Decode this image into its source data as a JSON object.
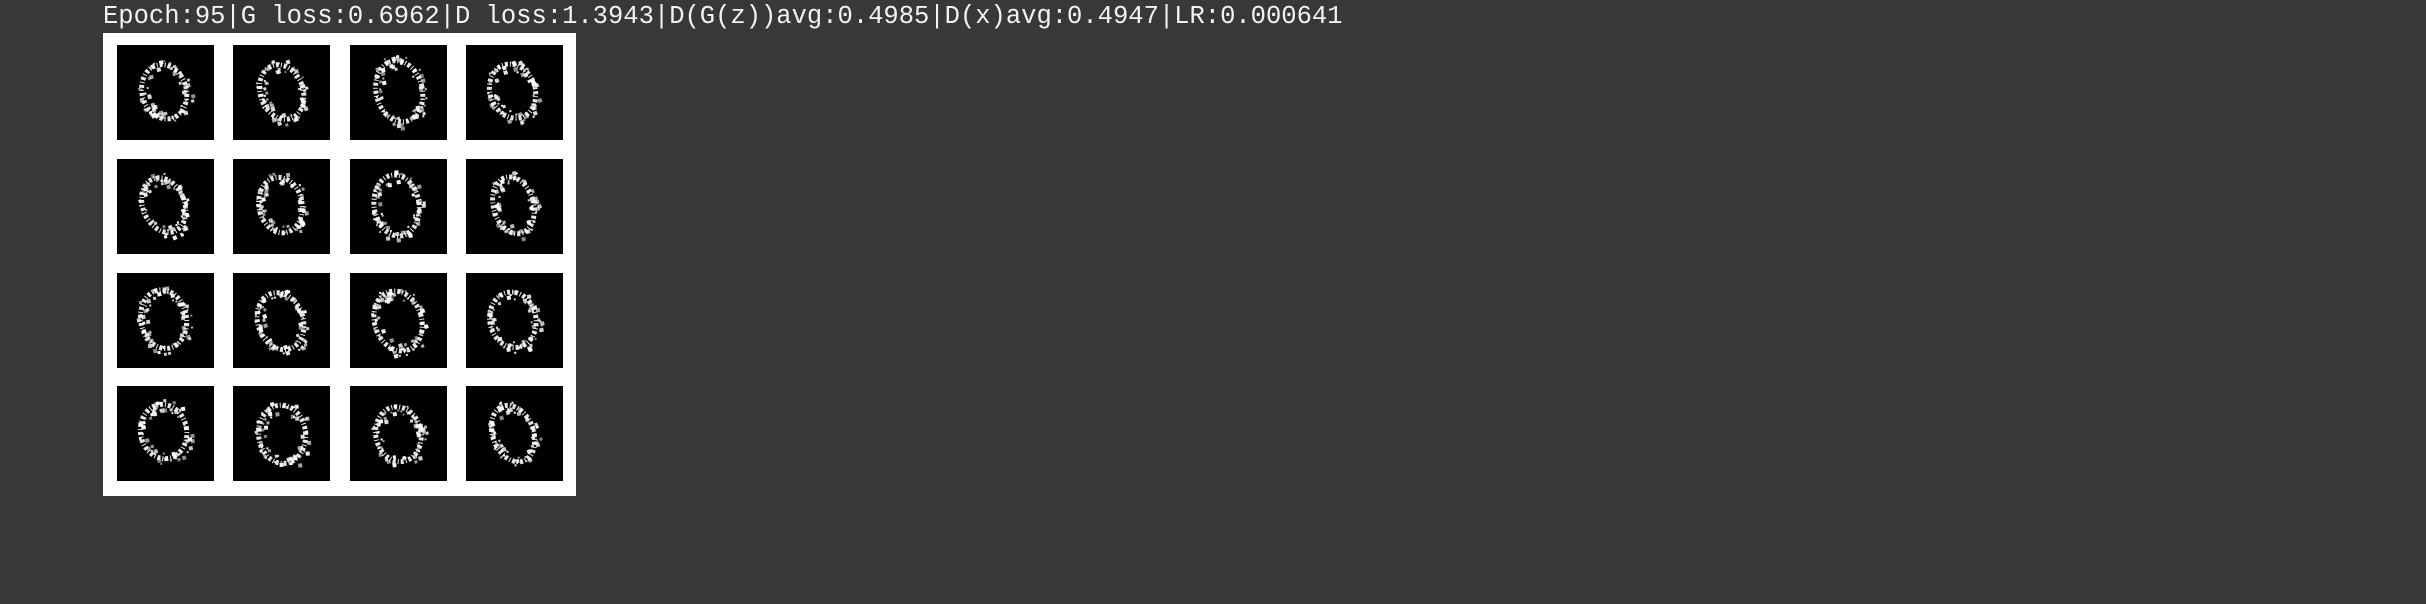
{
  "training_log": {
    "line": "Epoch:95|G loss:0.6962|D loss:1.3943|D(G(z))avg:0.4985|D(x)avg:0.4947|LR:0.000641"
  },
  "samples_grid": {
    "rows": 4,
    "cols": 4,
    "content": "generated digit samples"
  },
  "colors": {
    "background": "#383838",
    "text": "#f2f2f2",
    "figure_background": "#ffffff",
    "tile_background": "#000000",
    "digit_stroke": "#ffffff"
  }
}
